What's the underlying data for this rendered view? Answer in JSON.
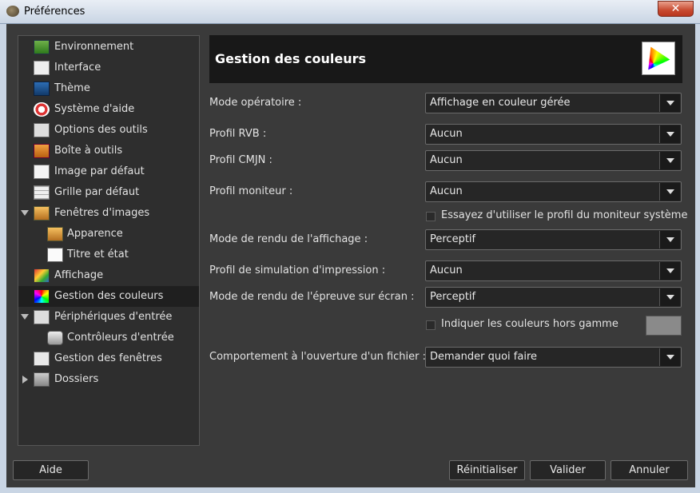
{
  "window": {
    "title": "Préférences",
    "close_label": "✕"
  },
  "sidebar": {
    "items": [
      {
        "label": "Environnement",
        "icon": "environment-icon",
        "selected": false
      },
      {
        "label": "Interface",
        "icon": "interface-icon",
        "selected": false
      },
      {
        "label": "Thème",
        "icon": "theme-icon",
        "selected": false
      },
      {
        "label": "Système d'aide",
        "icon": "help-system-icon",
        "selected": false
      },
      {
        "label": "Options des outils",
        "icon": "tool-options-icon",
        "selected": false
      },
      {
        "label": "Boîte à outils",
        "icon": "toolbox-icon",
        "selected": false
      },
      {
        "label": "Image par défaut",
        "icon": "default-image-icon",
        "selected": false
      },
      {
        "label": "Grille par défaut",
        "icon": "default-grid-icon",
        "selected": false
      },
      {
        "label": "Fenêtres d'images",
        "icon": "image-windows-icon",
        "selected": false,
        "expanded": true
      },
      {
        "label": "Apparence",
        "icon": "appearance-icon",
        "selected": false
      },
      {
        "label": "Titre et état",
        "icon": "title-status-icon",
        "selected": false
      },
      {
        "label": "Affichage",
        "icon": "display-icon",
        "selected": false
      },
      {
        "label": "Gestion des couleurs",
        "icon": "color-management-icon",
        "selected": true
      },
      {
        "label": "Périphériques d'entrée",
        "icon": "input-devices-icon",
        "selected": false,
        "expanded": true
      },
      {
        "label": "Contrôleurs d'entrée",
        "icon": "input-controllers-icon",
        "selected": false
      },
      {
        "label": "Gestion des fenêtres",
        "icon": "window-management-icon",
        "selected": false
      },
      {
        "label": "Dossiers",
        "icon": "folders-icon",
        "selected": false,
        "expanded": false
      }
    ]
  },
  "header": {
    "title": "Gestion des couleurs",
    "icon": "color-gamut-icon"
  },
  "form": {
    "mode_label": "Mode opératoire :",
    "mode_value": "Affichage en couleur gérée",
    "rgb_label": "Profil RVB :",
    "rgb_value": "Aucun",
    "cmyk_label": "Profil CMJN :",
    "cmyk_value": "Aucun",
    "monitor_label": "Profil moniteur :",
    "monitor_value": "Aucun",
    "system_profile_label": "Essayez d'utiliser le profil du moniteur système",
    "system_profile_checked": false,
    "render_label": "Mode de rendu de l'affichage :",
    "render_value": "Perceptif",
    "sim_label": "Profil de simulation d'impression :",
    "sim_value": "Aucun",
    "proof_label": "Mode de rendu de l'épreuve sur écran :",
    "proof_value": "Perceptif",
    "gamut_label": "Indiquer les couleurs hors gamme",
    "gamut_checked": false,
    "gamut_color": "#8a8a8a",
    "open_label": "Comportement à l'ouverture d'un fichier :",
    "open_value": "Demander quoi faire"
  },
  "buttons": {
    "help": "Aide",
    "reset": "Réinitialiser",
    "ok": "Valider",
    "cancel": "Annuler"
  }
}
